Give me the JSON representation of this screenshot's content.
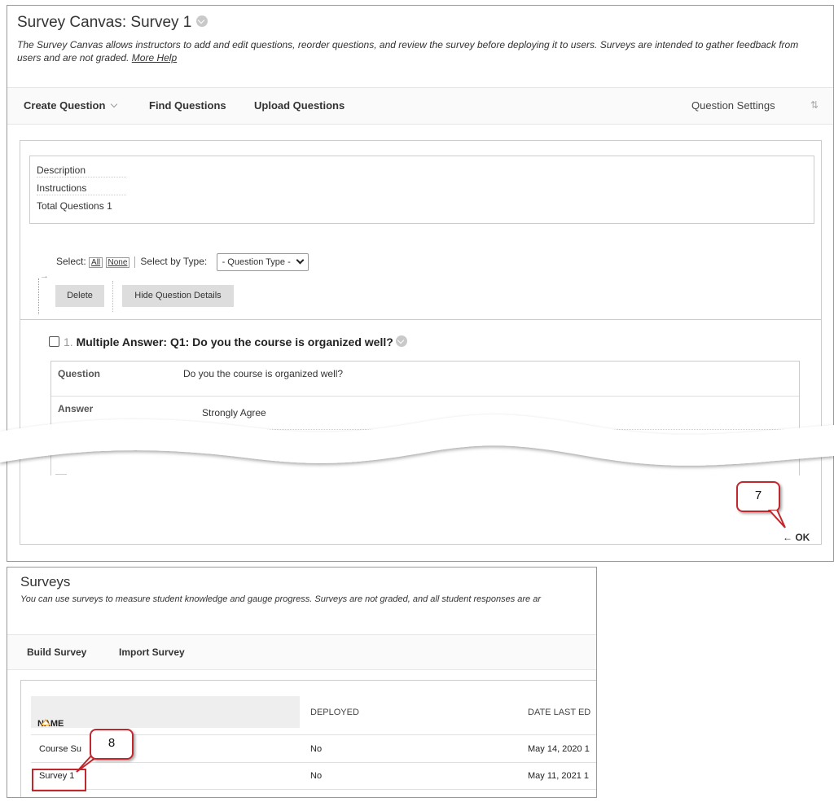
{
  "canvas": {
    "title": "Survey Canvas: Survey 1",
    "description": "The Survey Canvas allows instructors to add and edit questions, reorder questions, and review the survey before deploying it to users. Surveys are intended to gather feedback from users and are not graded.",
    "more_help": "More Help",
    "toolbar": {
      "create_question": "Create Question",
      "find_questions": "Find Questions",
      "upload_questions": "Upload Questions",
      "question_settings": "Question Settings",
      "sort_icon": "⇅"
    },
    "meta": {
      "description_label": "Description",
      "instructions_label": "Instructions",
      "total_label": "Total Questions",
      "total_value": "1"
    },
    "select": {
      "label": "Select:",
      "all": "All",
      "none": "None",
      "by_type": "Select by Type:",
      "type_value": "- Question Type -"
    },
    "buttons": {
      "delete": "Delete",
      "hide_details": "Hide Question Details"
    },
    "question": {
      "number": "1.",
      "heading": "Multiple Answer: Q1: Do you the course is organized well?",
      "question_label": "Question",
      "question_text": "Do you the course is organized well?",
      "answer_label": "Answer",
      "answer_1": "Strongly Agree"
    },
    "ok": "OK",
    "ok_arrow": "←",
    "callout": "7"
  },
  "surveys": {
    "title": "Surveys",
    "description": "You can use surveys to measure student knowledge and gauge progress. Surveys are not graded, and all student responses are ar",
    "toolbar": {
      "build": "Build Survey",
      "import": "Import Survey"
    },
    "columns": {
      "name": "NAME",
      "deployed": "DEPLOYED",
      "date": "DATE LAST ED"
    },
    "rows": [
      {
        "name": "Course Su",
        "deployed": "No",
        "date": "May 14, 2020 1"
      },
      {
        "name": "Survey 1",
        "deployed": "No",
        "date": "May 11, 2021 1"
      }
    ],
    "callout": "8"
  },
  "colors": {
    "callout_border": "#c1272d",
    "sort_arrow": "#e8a437"
  }
}
